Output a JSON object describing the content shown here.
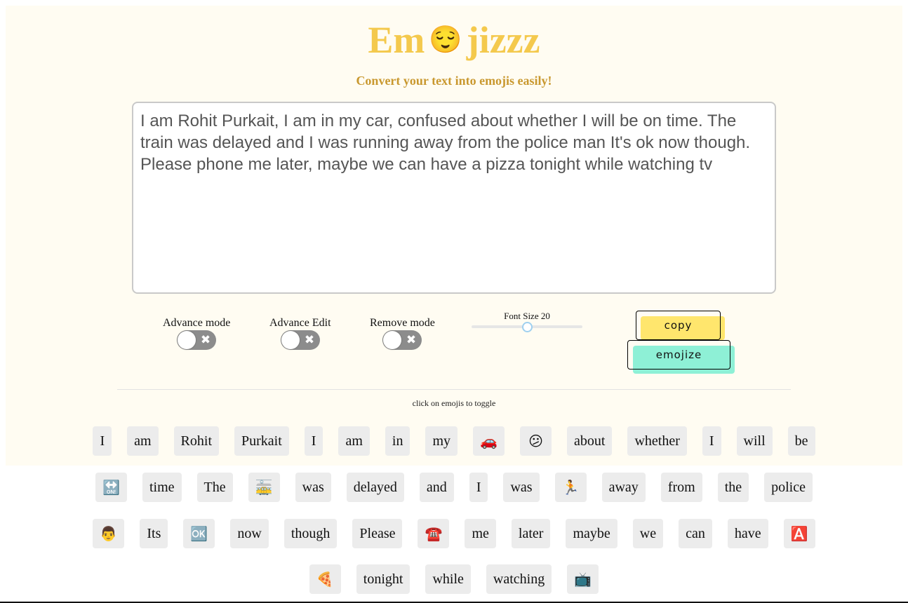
{
  "header": {
    "title_left": "Em",
    "title_emoji": "😌",
    "title_right": "jizzz",
    "subtitle": "Convert your text into emojis easily!"
  },
  "editor": {
    "text": "I am Rohit Purkait, I am in my car, confused about whether I will be on time. The train was delayed and I was running away from the police man It's ok now though. Please phone me later, maybe we can have a pizza tonight while watching tv"
  },
  "controls": {
    "advance_mode_label": "Advance mode",
    "advance_edit_label": "Advance Edit",
    "remove_mode_label": "Remove mode",
    "toggle_off_icon": "✖",
    "font_size_label": "Font Size 20",
    "font_size_value": 20,
    "copy_label": "copy",
    "emojize_label": "emojize"
  },
  "colors": {
    "copy_button": "#ffe66d",
    "emojize_button": "#8ef0d6",
    "title": "#f4c94d",
    "subtitle": "#c9982f"
  },
  "output": {
    "hint": "click on emojis to toggle",
    "rows": [
      [
        "I",
        "am",
        "Rohit",
        "Purkait",
        "I",
        "am",
        "in",
        "my",
        "🚗",
        "😕",
        "about",
        "whether",
        "I",
        "will",
        "be"
      ],
      [
        "🔛",
        "time",
        "The",
        "🚋",
        "was",
        "delayed",
        "and",
        "I",
        "was",
        "🏃",
        "away",
        "from",
        "the",
        "police"
      ],
      [
        "👨",
        "Its",
        "🆗",
        "now",
        "though",
        "Please",
        "☎️",
        "me",
        "later",
        "maybe",
        "we",
        "can",
        "have",
        "🅰️"
      ],
      [
        "🍕",
        "tonight",
        "while",
        "watching",
        "📺"
      ]
    ]
  }
}
